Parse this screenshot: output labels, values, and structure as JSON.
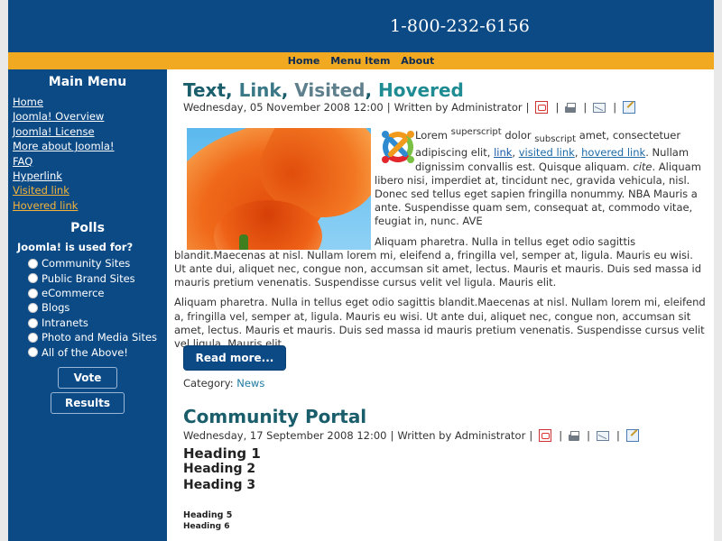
{
  "header": {
    "phone": "1-800-232-6156"
  },
  "topnav": {
    "items": [
      "Home",
      "Menu Item",
      "About"
    ]
  },
  "sidebar": {
    "main_menu_title": "Main Menu",
    "menu_items": [
      "Home",
      "Joomla! Overview",
      "Joomla! License",
      "More about Joomla!",
      "FAQ",
      "Hyperlink",
      "Visited link",
      "Hovered link"
    ],
    "polls_title": "Polls",
    "poll_question": "Joomla! is used for?",
    "poll_options": [
      "Community Sites",
      "Public Brand Sites",
      "eCommerce",
      "Blogs",
      "Intranets",
      "Photo and Media Sites",
      "All of the Above!"
    ],
    "vote_label": "Vote",
    "results_label": "Results"
  },
  "article1": {
    "title_parts": [
      "Text",
      ", ",
      "Link",
      ", ",
      "Visited",
      ", ",
      "Hovered"
    ],
    "date": "Wednesday, 05 November 2008 12:00",
    "sep": "|",
    "author": "Written by Administrator",
    "p1": {
      "t1": "Lorem ",
      "sup": "superscript",
      "t2": " dolor ",
      "sub": "subscript",
      "t3": " amet, consectetuer adipiscing elit, ",
      "link": "link",
      "c1": ", ",
      "visited": "visited link",
      "c2": ", ",
      "hovered": "hovered link",
      "t4": ". Nullam dignissim convallis est. Quisque aliquam. ",
      "cite": "cite",
      "t5": ". Aliquam libero nisi, imperdiet at, tincidunt nec, gravida vehicula, nisl. Donec sed tellus eget sapien fringilla nonummy. NBA Mauris a ante. Suspendisse quam sem, consequat at, commodo vitae, feugiat in, nunc. AVE"
    },
    "p2": "Aliquam pharetra. Nulla in tellus eget odio sagittis blandit.Maecenas at nisl. Nullam lorem mi, eleifend a, fringilla vel, semper at, ligula. Mauris eu wisi. Ut ante dui, aliquet nec, congue non, accumsan sit amet, lectus. Mauris et mauris. Duis sed massa id mauris pretium venenatis. Suspendisse cursus velit vel ligula. Mauris elit.",
    "p3": "Aliquam pharetra. Nulla in tellus eget odio sagittis blandit.Maecenas at nisl. Nullam lorem mi, eleifend a, fringilla vel, semper at, ligula. Mauris eu wisi. Ut ante dui, aliquet nec, congue non, accumsan sit amet, lectus. Mauris et mauris. Duis sed massa id mauris pretium venenatis. Suspendisse cursus velit vel ligula. Mauris elit.",
    "readmore": "Read more...",
    "category_label": "Category: ",
    "category_value": "News"
  },
  "article2": {
    "title": "Community Portal",
    "date": "Wednesday, 17 September 2008 12:00",
    "sep": "|",
    "author": "Written by Administrator",
    "h1": "Heading 1",
    "h2": "Heading 2",
    "h3": "Heading 3",
    "h5": "Heading 5",
    "h6": "Heading 6"
  },
  "colors": {
    "brand_blue": "#0c4a86",
    "nav_gold": "#f2a922",
    "title_teal": "#1a5d6b",
    "visited_link_gold": "#f2b33a"
  }
}
